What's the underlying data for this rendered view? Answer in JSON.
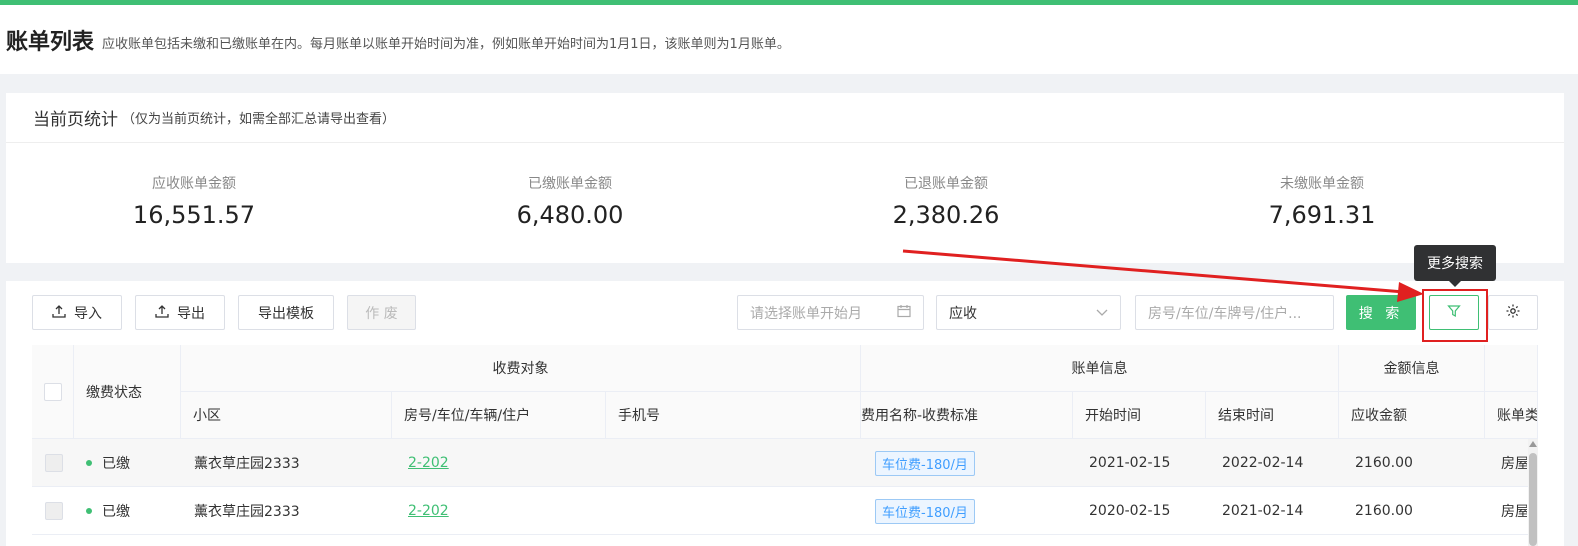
{
  "header": {
    "title": "账单列表",
    "description": "应收账单包括未缴和已缴账单在内。每月账单以账单开始时间为准，例如账单开始时间为1月1日，该账单则为1月账单。"
  },
  "stats": {
    "title": "当前页统计",
    "note": "（仅为当前页统计，如需全部汇总请导出查看）",
    "items": [
      {
        "label": "应收账单金额",
        "value": "16,551.57"
      },
      {
        "label": "已缴账单金额",
        "value": "6,480.00"
      },
      {
        "label": "已退账单金额",
        "value": "2,380.26"
      },
      {
        "label": "未缴账单金额",
        "value": "7,691.31"
      }
    ]
  },
  "toolbar": {
    "import_label": "导入",
    "export_label": "导出",
    "export_template_label": "导出模板",
    "void_label": "作 废",
    "month_placeholder": "请选择账单开始月",
    "type_value": "应收",
    "keyword_placeholder": "房号/车位/车牌号/住户...",
    "search_label": "搜 索",
    "more_search_tooltip": "更多搜索"
  },
  "table": {
    "group_headers": {
      "status": "缴费状态",
      "target": "收费对象",
      "bill": "账单信息",
      "amount": "金额信息"
    },
    "columns": {
      "community": "小区",
      "room": "房号/车位/车辆/住户",
      "phone": "手机号",
      "fee": "费用名称-收费标准",
      "start": "开始时间",
      "end": "结束时间",
      "receivable": "应收金额",
      "type": "账单类"
    },
    "rows": [
      {
        "status": "已缴",
        "community": "薰衣草庄园2333",
        "room": "2-202",
        "phone": "",
        "fee": "车位费-180/月",
        "start": "2021-02-15",
        "end": "2022-02-14",
        "receivable": "2160.00",
        "type": "房屋"
      },
      {
        "status": "已缴",
        "community": "薰衣草庄园2333",
        "room": "2-202",
        "phone": "",
        "fee": "车位费-180/月",
        "start": "2020-02-15",
        "end": "2021-02-14",
        "receivable": "2160.00",
        "type": "房屋"
      }
    ]
  },
  "colors": {
    "accent": "#3fbf74",
    "annotation": "#e02020"
  }
}
